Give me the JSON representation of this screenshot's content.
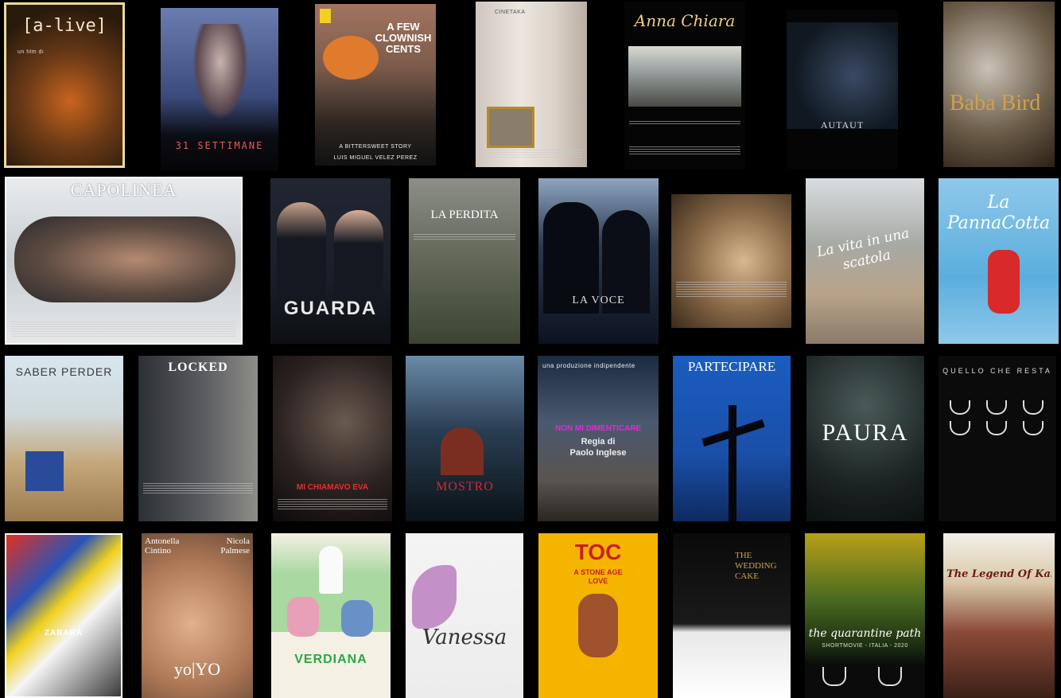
{
  "posters": [
    {
      "id": "a-live",
      "title": "[a-live]",
      "subtitle": "un film di"
    },
    {
      "id": "31-settimane",
      "title": "31 SETTIMANE"
    },
    {
      "id": "a-few-clownish-cents",
      "title": "A FEW CLOWNISH CENTS",
      "tagline": "A BITTERSWEET STORY",
      "credit": "LUIS MIGUEL VÉLEZ PÉREZ"
    },
    {
      "id": "cinetaka",
      "title": "CINETAKA"
    },
    {
      "id": "anna-chiara",
      "title": "Anna Chiara"
    },
    {
      "id": "autaut",
      "title": "AUTAUT"
    },
    {
      "id": "baba-bird",
      "title": "Baba Bird"
    },
    {
      "id": "capolinea",
      "title": "CAPOLINEA"
    },
    {
      "id": "guarda",
      "title": "GUARDA"
    },
    {
      "id": "la-perdita",
      "title": "LA PERDITA"
    },
    {
      "id": "la-voce",
      "title": "LA VOCE"
    },
    {
      "id": "untitled-woman",
      "title": ""
    },
    {
      "id": "la-vita-in-una-scatola",
      "title": "La vita in una scatola"
    },
    {
      "id": "la-panna-cotta",
      "title": "La PannaCotta"
    },
    {
      "id": "saber-perder",
      "title": "SABER PERDER"
    },
    {
      "id": "locked",
      "title": "LOCKED"
    },
    {
      "id": "mi-chiamavo-eva",
      "title": "MI CHIAMAVO EVA"
    },
    {
      "id": "mostro",
      "title": "MOSTRO"
    },
    {
      "id": "non-mi-dimenticare",
      "title": "NON MI DIMENTICARE",
      "top": "una produzione indipendente",
      "director": "Regia di",
      "director_name": "Paolo Inglese"
    },
    {
      "id": "partecipare",
      "title": "PARTECIPARE"
    },
    {
      "id": "paura",
      "title": "PAURA"
    },
    {
      "id": "quello-che-resta",
      "title": "QUELLO CHE RESTA"
    },
    {
      "id": "zabara",
      "title": "ZABARA"
    },
    {
      "id": "yoyo",
      "title": "yo|YO",
      "actor1": "Antonella Cintino",
      "actor2": "Nicola Palmese"
    },
    {
      "id": "verdiana",
      "title": "VERDIANA"
    },
    {
      "id": "vanessa",
      "title": "Vanessa"
    },
    {
      "id": "toc",
      "title": "TOC",
      "subtitle": "A STONE AGE LOVE"
    },
    {
      "id": "the-wedding-cake",
      "title": "THE WEDDING CAKE"
    },
    {
      "id": "the-quarantine-path",
      "title": "the quarantine path",
      "subtitle": "SHORTMOVIE - ITALIA - 2020"
    },
    {
      "id": "the-legend-of-kaira",
      "title": "The Legend Of Kaira"
    }
  ],
  "colors": {
    "background": "#000000",
    "accent_red": "#c8202a",
    "toc_yellow": "#f4b400",
    "partecipare_blue": "#1a4fa8"
  }
}
